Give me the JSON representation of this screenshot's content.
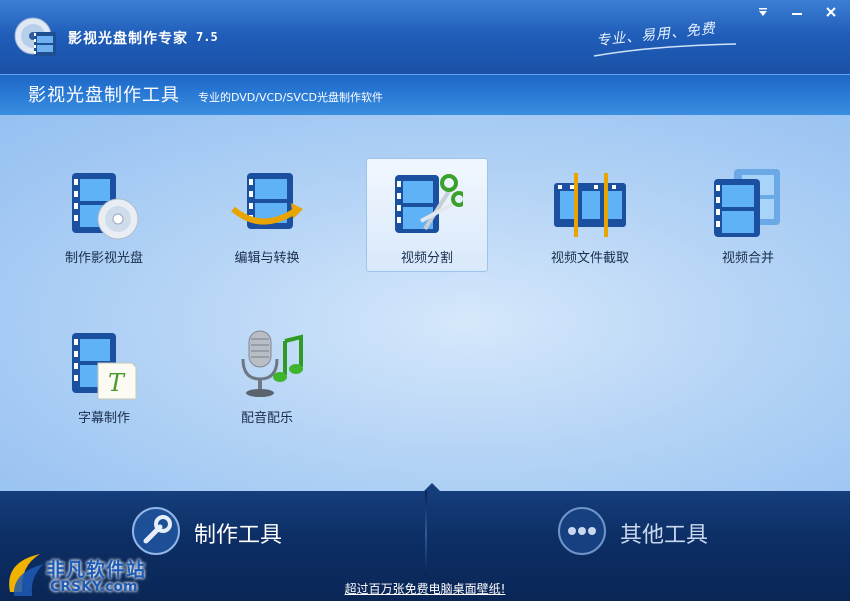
{
  "window": {
    "title": "影视光盘制作专家",
    "version": "7.5",
    "slogan": "专业、易用、免费",
    "controls": {
      "menu": "▼",
      "minimize": "—",
      "close": "✕"
    }
  },
  "subheader": {
    "title": "影视光盘制作工具",
    "description": "专业的DVD/VCD/SVCD光盘制作软件"
  },
  "tools": [
    {
      "label": "制作影视光盘",
      "icon": "film-disc-icon"
    },
    {
      "label": "编辑与转换",
      "icon": "film-convert-icon"
    },
    {
      "label": "视频分割",
      "icon": "film-scissors-icon",
      "selected": true
    },
    {
      "label": "视频文件截取",
      "icon": "film-clip-icon"
    },
    {
      "label": "视频合并",
      "icon": "film-merge-icon"
    },
    {
      "label": "字幕制作",
      "icon": "film-subtitle-icon"
    },
    {
      "label": "配音配乐",
      "icon": "microphone-music-icon"
    }
  ],
  "bottom_tabs": [
    {
      "label": "制作工具",
      "icon": "wrench-icon",
      "active": true
    },
    {
      "label": "其他工具",
      "icon": "more-dots-icon",
      "active": false
    }
  ],
  "notice": "超过百万张免费电脑桌面壁纸!",
  "watermark": {
    "cn": "非凡软件站",
    "en": "CRSKY.com"
  },
  "colors": {
    "accent": "#1f5db9",
    "bottom": "#0d2f66"
  }
}
